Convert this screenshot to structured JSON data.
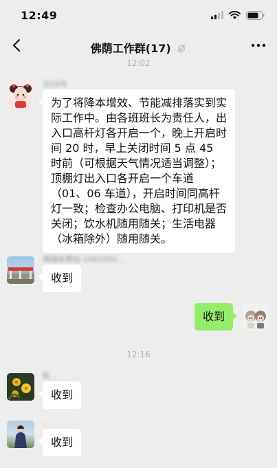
{
  "status_bar": {
    "time": "12:49"
  },
  "header": {
    "title": "佛荫工作群(17)"
  },
  "timestamps": [
    "12:02",
    "12:16"
  ],
  "messages": [
    {
      "sender": "吕18号",
      "text": "为了将降本增效、节能减排落实到实际工作中。由各班班长为责任人，出入口高杆灯各开启一个，晚上开启时间 20 时，早上关闭时间 5 点 45 时前（可根据天气情况适当调整）；顶棚灯出入口各开启一个车道（01、06 车道），开启时间同高杆灯一致；检查办公电脑、打印机是否关闭；饮水机随用随关；生活电器（冰箱除外）随用随关。"
    },
    {
      "sender": "佛荫收费站-1881000...",
      "text": "收到"
    },
    {
      "sender": "",
      "text": "收到"
    },
    {
      "sender": "陈...",
      "text": "收到"
    },
    {
      "sender": "...",
      "text": "收到"
    }
  ],
  "colors": {
    "background": "#ededed",
    "my_bubble": "#95ec69",
    "other_bubble": "#ffffff"
  }
}
